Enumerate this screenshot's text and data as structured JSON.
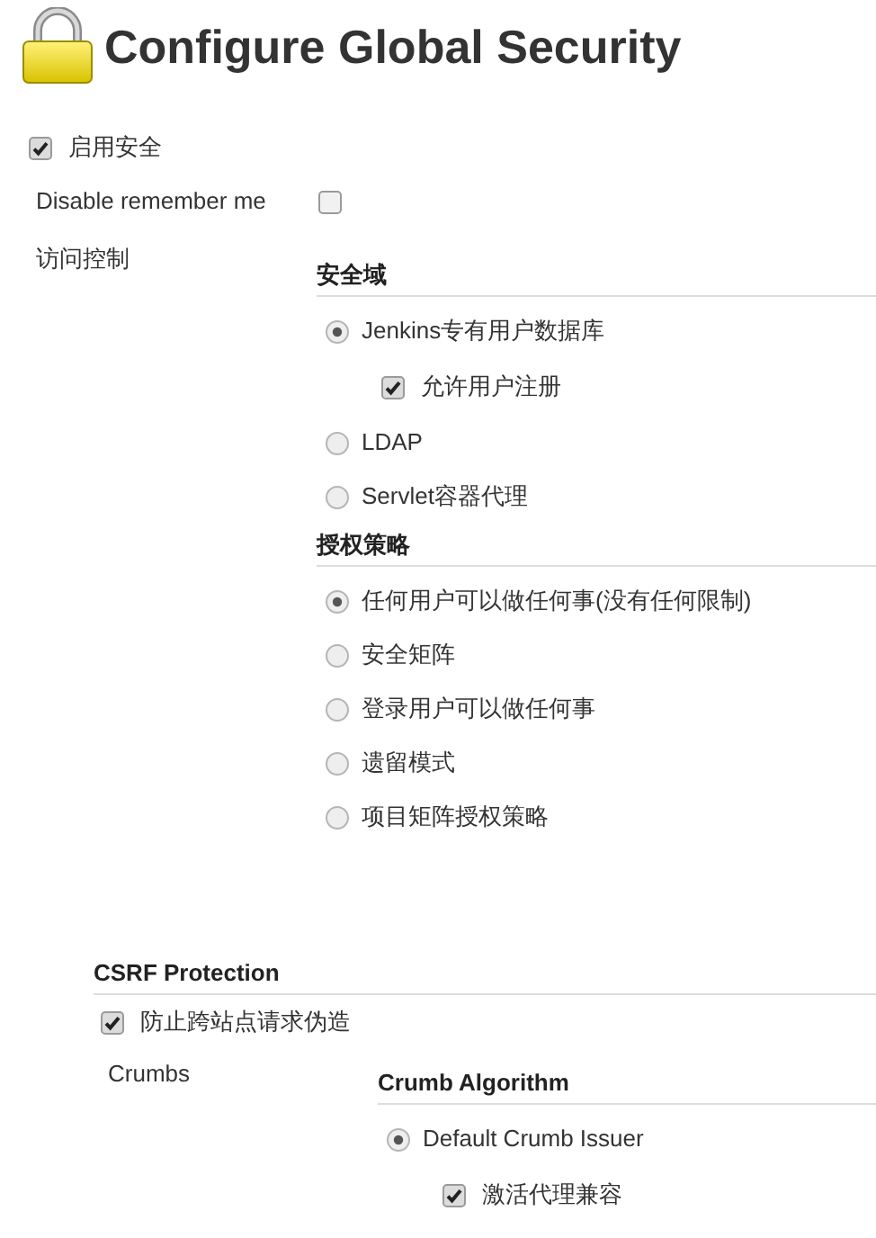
{
  "header": {
    "title": "Configure Global Security"
  },
  "enable_security": {
    "label": "启用安全",
    "checked": true
  },
  "disable_remember_me": {
    "label": "Disable remember me",
    "checked": false
  },
  "access_control": {
    "label": "访问控制",
    "sections": [
      {
        "title": "安全域",
        "options": [
          {
            "label": "Jenkins专有用户数据库",
            "selected": true,
            "sub_options": [
              {
                "label": "允许用户注册",
                "checked": true
              }
            ]
          },
          {
            "label": "LDAP",
            "selected": false
          },
          {
            "label": "Servlet容器代理",
            "selected": false
          }
        ]
      },
      {
        "title": "授权策略",
        "options": [
          {
            "label": "任何用户可以做任何事(没有任何限制)",
            "selected": true
          },
          {
            "label": "安全矩阵",
            "selected": false
          },
          {
            "label": "登录用户可以做任何事",
            "selected": false
          },
          {
            "label": "遗留模式",
            "selected": false
          },
          {
            "label": "项目矩阵授权策略",
            "selected": false
          }
        ]
      }
    ]
  },
  "csrf": {
    "title": "CSRF Protection",
    "checkbox": {
      "label": "防止跨站点请求伪造",
      "checked": true
    },
    "crumbs": {
      "label": "Crumbs",
      "sections": [
        {
          "title": "Crumb Algorithm",
          "options": [
            {
              "label": "Default Crumb Issuer",
              "selected": true,
              "sub_options": [
                {
                  "label": "激活代理兼容",
                  "checked": true
                }
              ]
            }
          ]
        }
      ]
    }
  }
}
